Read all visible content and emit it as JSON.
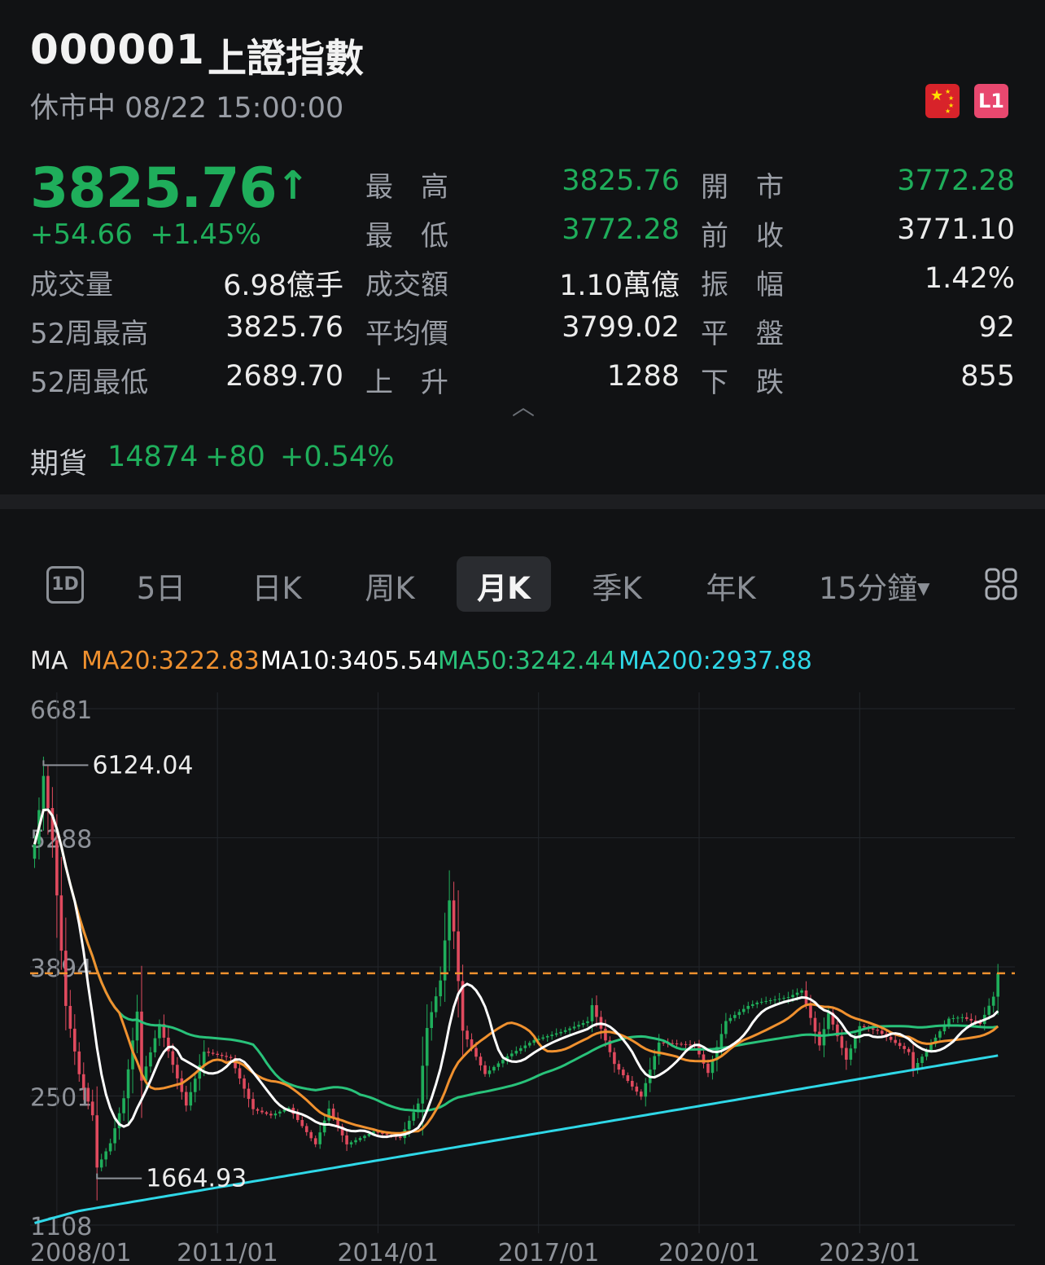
{
  "header": {
    "code": "000001",
    "name": "上證指數",
    "status": "休市中 08/22 15:00:00",
    "flag_icon": "china-flag-icon",
    "l1_icon": "level1-badge-icon",
    "l1_text": "L1"
  },
  "quote": {
    "price": "3825.76",
    "change": "+54.66",
    "change_pct": "+1.45%",
    "up_arrow": "↑"
  },
  "stats": [
    {
      "label": "成交量",
      "value": "6.98億手"
    },
    {
      "label": "52周最高",
      "value": "3825.76"
    },
    {
      "label": "52周最低",
      "value": "2689.70"
    },
    {
      "label": "最　高",
      "value": "3825.76",
      "green": true
    },
    {
      "label": "最　低",
      "value": "3772.28",
      "green": true
    },
    {
      "label": "成交額",
      "value": "1.10萬億"
    },
    {
      "label": "平均價",
      "value": "3799.02"
    },
    {
      "label": "上　升",
      "value": "1288"
    },
    {
      "label": "開　市",
      "value": "3772.28",
      "green": true
    },
    {
      "label": "前　收",
      "value": "3771.10"
    },
    {
      "label": "振　幅",
      "value": "1.42%"
    },
    {
      "label": "平　盤",
      "value": "92"
    },
    {
      "label": "下　跌",
      "value": "855"
    }
  ],
  "futures": {
    "label": "期貨",
    "price": "14874",
    "change": "+80",
    "change_pct": "+0.54%"
  },
  "tabs": [
    {
      "label": "1D",
      "icon": "1d-icon"
    },
    {
      "label": "5日"
    },
    {
      "label": "日K"
    },
    {
      "label": "周K"
    },
    {
      "label": "月K",
      "active": true
    },
    {
      "label": "季K"
    },
    {
      "label": "年K"
    },
    {
      "label": "15分鐘"
    }
  ],
  "more_icon": "grid-icon",
  "ma_legend": [
    {
      "text": "MA",
      "color": "#e6e6e6"
    },
    {
      "text": "MA20:3222.83",
      "color": "#f0912f"
    },
    {
      "text": "MA10:3405.54",
      "color": "#ffffff"
    },
    {
      "text": "MA50:3242.44",
      "color": "#29c27a"
    },
    {
      "text": "MA200:2937.88",
      "color": "#2fd8e8"
    }
  ],
  "colors": {
    "up": "#1fae5b",
    "down": "#e04a5e",
    "ma20": "#f0912f",
    "ma10": "#ffffff",
    "ma50": "#29c27a",
    "ma200": "#2fd8e8",
    "ref_line": "#f0912f"
  },
  "chart_data": {
    "type": "candlestick",
    "interval": "monthly",
    "y_ticks": [
      "6681",
      "5288",
      "3894",
      "2501",
      "1108"
    ],
    "x_ticks": [
      "2008/01",
      "2011/01",
      "2014/01",
      "2017/01",
      "2020/01",
      "2023/01"
    ],
    "ylim": [
      1108,
      6681
    ],
    "reference_line": 3825.76,
    "annotations": [
      {
        "label": "6124.04",
        "value": 6124.04,
        "date": "2007/10"
      },
      {
        "label": "1664.93",
        "value": 1664.93,
        "date": "2008/10"
      }
    ],
    "series_close": [
      [
        "2007/08",
        5218
      ],
      [
        "2007/10",
        5955
      ],
      [
        "2007/12",
        5262
      ],
      [
        "2008/03",
        3473
      ],
      [
        "2008/06",
        2736
      ],
      [
        "2008/09",
        2293
      ],
      [
        "2008/10",
        1729
      ],
      [
        "2009/01",
        1991
      ],
      [
        "2009/04",
        2477
      ],
      [
        "2009/07",
        3412
      ],
      [
        "2009/08",
        2667
      ],
      [
        "2009/12",
        3277
      ],
      [
        "2010/06",
        2398
      ],
      [
        "2010/10",
        2979
      ],
      [
        "2011/04",
        2911
      ],
      [
        "2011/09",
        2359
      ],
      [
        "2012/01",
        2292
      ],
      [
        "2012/05",
        2373
      ],
      [
        "2012/11",
        1980
      ],
      [
        "2013/02",
        2365
      ],
      [
        "2013/06",
        1979
      ],
      [
        "2013/12",
        2116
      ],
      [
        "2014/06",
        2048
      ],
      [
        "2014/10",
        2420
      ],
      [
        "2014/12",
        3235
      ],
      [
        "2015/03",
        3748
      ],
      [
        "2015/05",
        4612
      ],
      [
        "2015/06",
        4277
      ],
      [
        "2015/08",
        3206
      ],
      [
        "2016/01",
        2738
      ],
      [
        "2016/06",
        2930
      ],
      [
        "2016/12",
        3104
      ],
      [
        "2017/06",
        3192
      ],
      [
        "2017/12",
        3307
      ],
      [
        "2018/01",
        3481
      ],
      [
        "2018/06",
        2847
      ],
      [
        "2018/10",
        2603
      ],
      [
        "2018/12",
        2494
      ],
      [
        "2019/04",
        3078
      ],
      [
        "2019/12",
        3050
      ],
      [
        "2020/03",
        2750
      ],
      [
        "2020/07",
        3310
      ],
      [
        "2020/12",
        3473
      ],
      [
        "2021/02",
        3509
      ],
      [
        "2021/09",
        3568
      ],
      [
        "2021/12",
        3640
      ],
      [
        "2022/04",
        3047
      ],
      [
        "2022/06",
        3399
      ],
      [
        "2022/10",
        2893
      ],
      [
        "2023/01",
        3255
      ],
      [
        "2023/05",
        3205
      ],
      [
        "2023/12",
        2975
      ],
      [
        "2024/01",
        2789
      ],
      [
        "2024/09",
        3336
      ],
      [
        "2024/12",
        3351
      ],
      [
        "2025/04",
        3279
      ],
      [
        "2025/07",
        3573
      ],
      [
        "2025/08",
        3825
      ]
    ]
  }
}
